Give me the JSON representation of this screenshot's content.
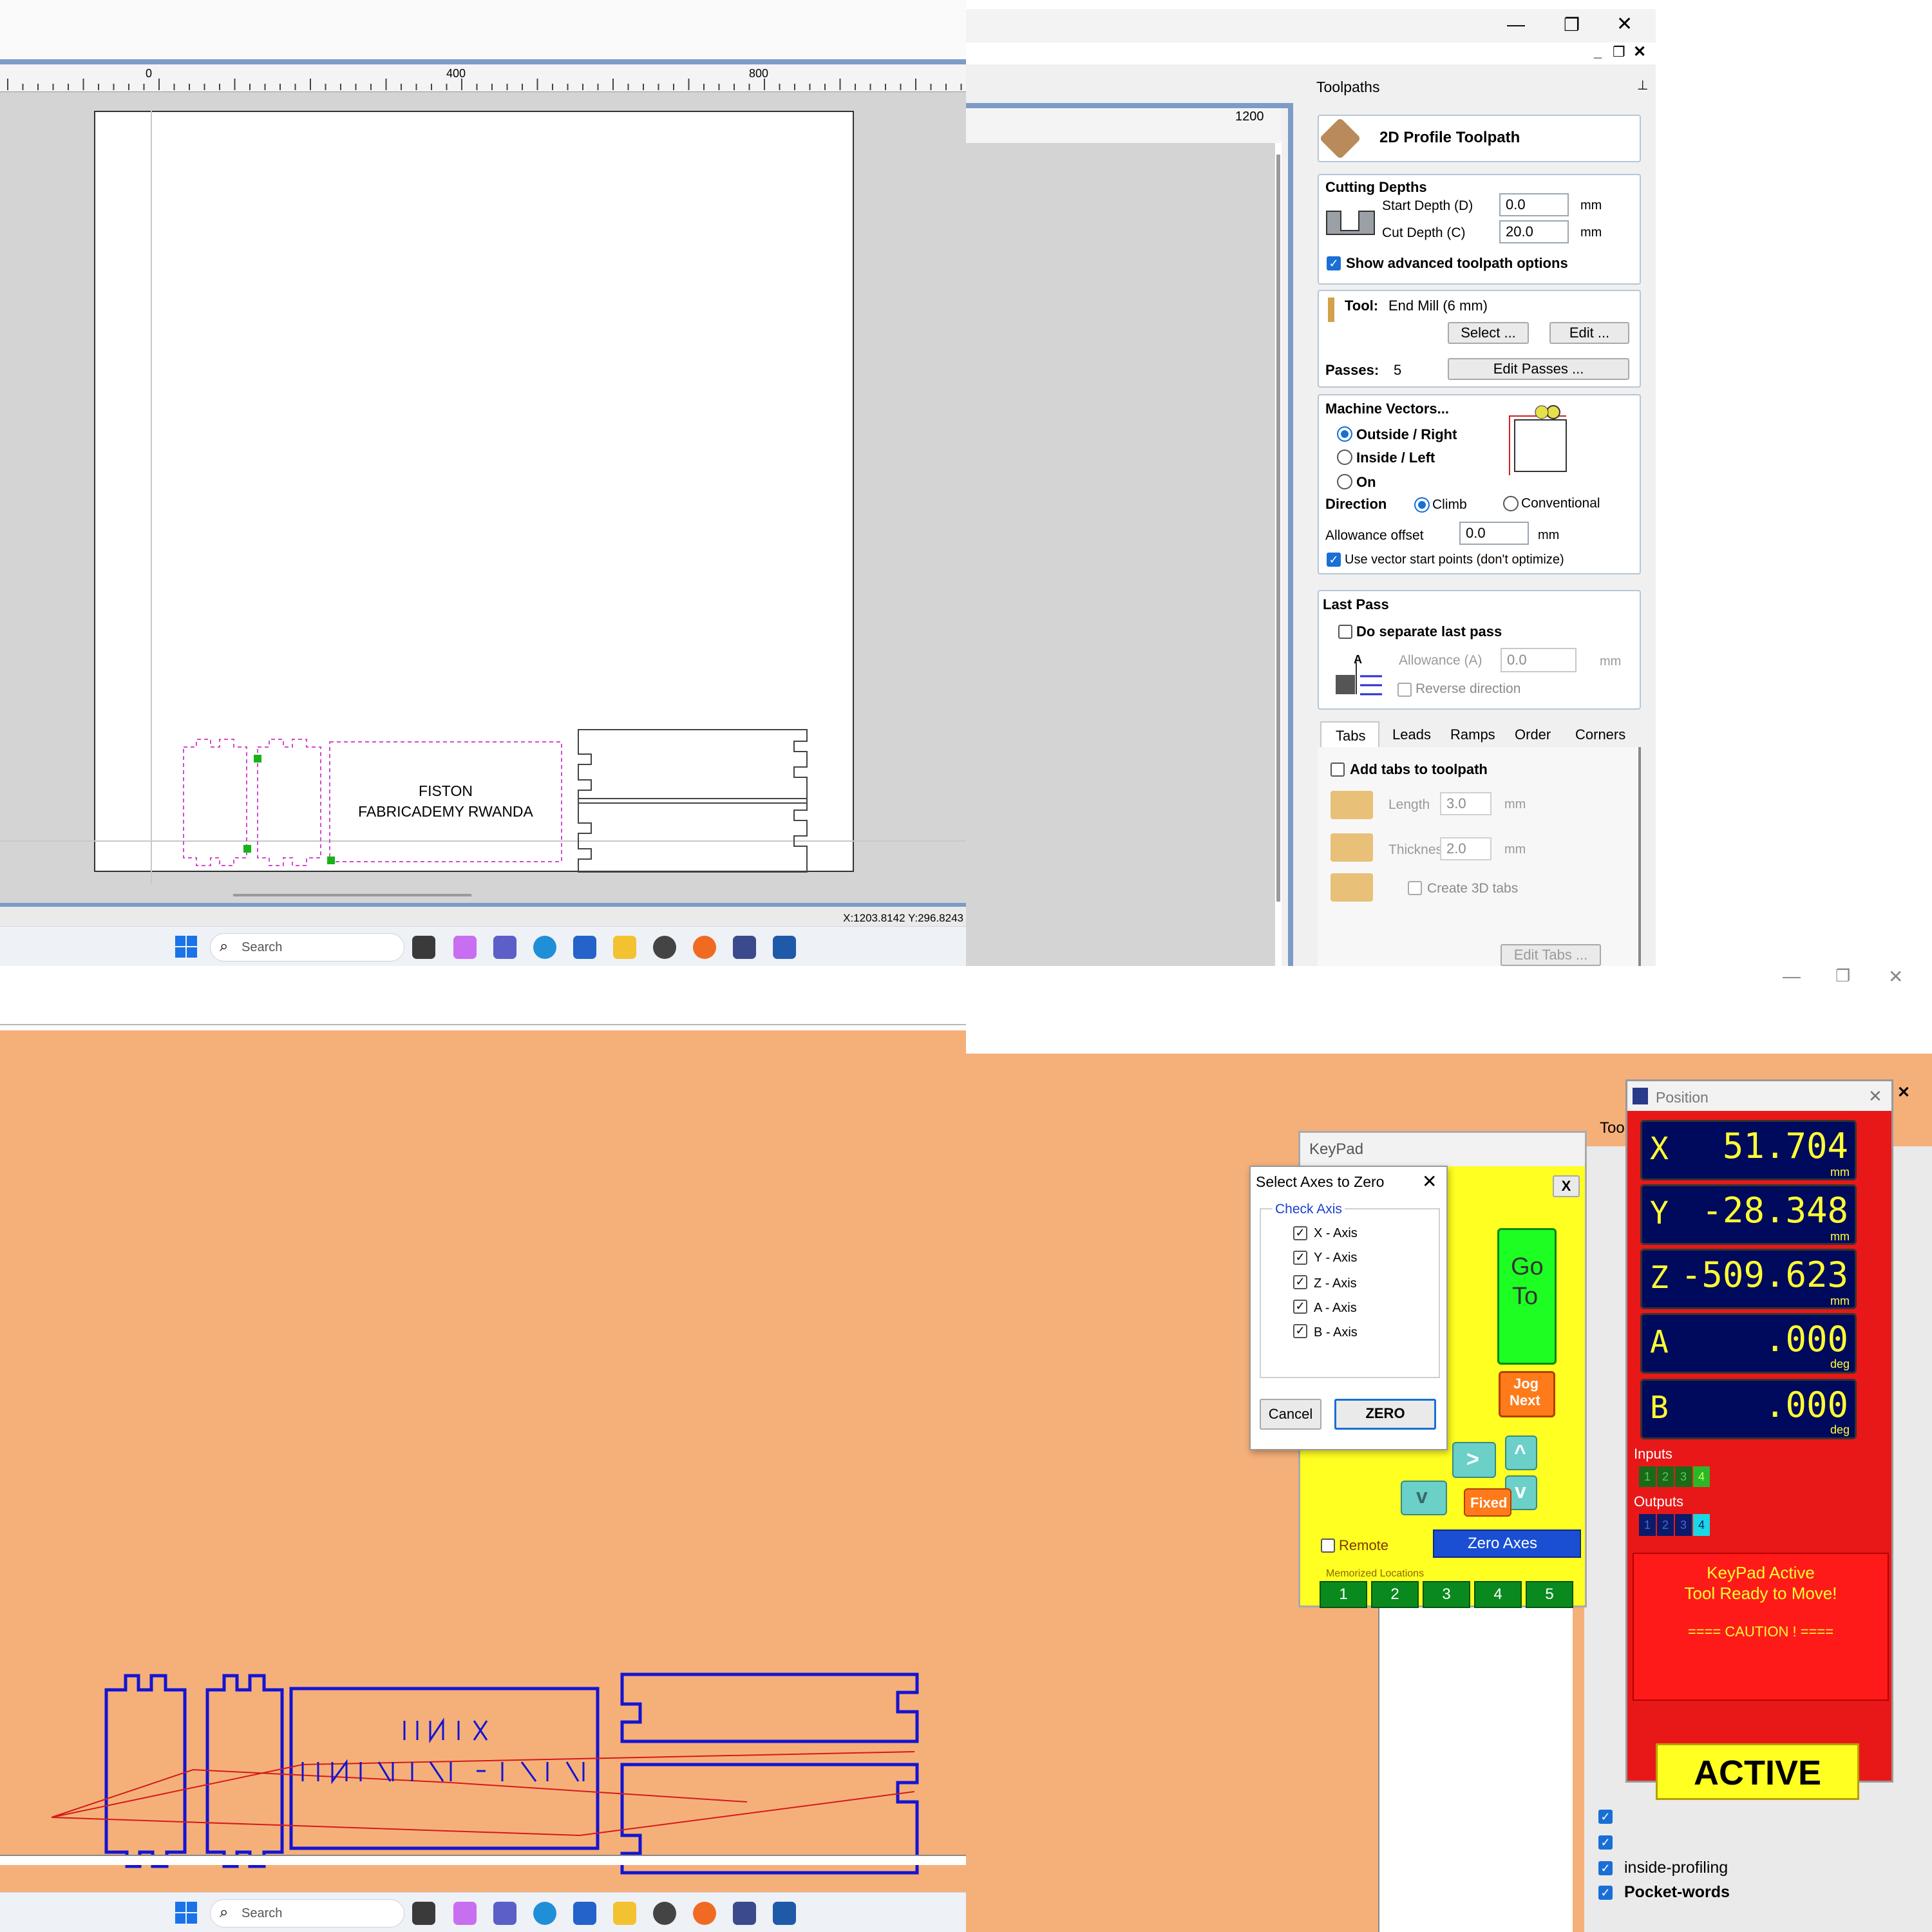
{
  "design_view": {
    "ruler_labels": [
      "0",
      "400",
      "800",
      "1200"
    ],
    "part_text_line1": "FISTON",
    "part_text_line2": "FABRICADEMY RWANDA",
    "coords": "X:1203.8142 Y:296.8243"
  },
  "window_controls": {
    "minimize": "—",
    "restore": "❐",
    "close": "✕"
  },
  "taskbar": {
    "search_placeholder": "Search"
  },
  "toolpaths": {
    "panel_title": "Toolpaths",
    "toolpath_name": "2D Profile Toolpath",
    "cutting_depths": {
      "title": "Cutting Depths",
      "start_label": "Start Depth (D)",
      "start_value": "0.0",
      "cut_label": "Cut Depth (C)",
      "cut_value": "20.0",
      "unit": "mm",
      "advanced_label": "Show advanced toolpath options"
    },
    "tool": {
      "label": "Tool:",
      "value": "End Mill (6 mm)",
      "select_btn": "Select ...",
      "edit_btn": "Edit ...",
      "passes_label": "Passes:",
      "passes_value": "5",
      "edit_passes_btn": "Edit Passes ..."
    },
    "machine_vectors": {
      "title": "Machine Vectors...",
      "outside": "Outside / Right",
      "inside": "Inside / Left",
      "on": "On",
      "direction_label": "Direction",
      "climb": "Climb",
      "conventional": "Conventional",
      "allowance_label": "Allowance offset",
      "allowance_value": "0.0",
      "unit": "mm",
      "start_points_label": "Use vector start points (don't optimize)"
    },
    "last_pass": {
      "title": "Last Pass",
      "separate_label": "Do separate last pass",
      "allowance_label": "Allowance (A)",
      "allowance_value": "0.0",
      "unit": "mm",
      "reverse_label": "Reverse direction",
      "a_letter": "A"
    },
    "tabs": [
      "Tabs",
      "Leads",
      "Ramps",
      "Order",
      "Corners"
    ],
    "tabs_section": {
      "add_tabs_label": "Add tabs to toolpath",
      "length_label": "Length",
      "length_value": "3.0",
      "thickness_label": "Thickness",
      "thickness_value": "2.0",
      "unit": "mm",
      "create3d_label": "Create 3D tabs",
      "edit_tabs_btn": "Edit Tabs ..."
    }
  },
  "cnc": {
    "select_axes_dialog": {
      "title": "Select Axes to Zero",
      "group_label": "Check Axis",
      "axes": [
        "X - Axis",
        "Y - Axis",
        "Z - Axis",
        "A - Axis",
        "B - Axis"
      ],
      "cancel_btn": "Cancel",
      "zero_btn": "ZERO"
    },
    "keypad": {
      "title": "KeyPad",
      "close": "X",
      "goto": [
        "Go",
        "To"
      ],
      "jog_next": [
        "Jog",
        "Next"
      ],
      "fixed": "Fixed",
      "remote": "Remote",
      "zero_axes": "Zero Axes",
      "memorized_label": "Memorized Locations",
      "memorized": [
        "1",
        "2",
        "3",
        "4",
        "5"
      ],
      "arrows": {
        "right": ">",
        "up": "^",
        "down": "v"
      }
    },
    "position": {
      "title": "Position",
      "axes": [
        {
          "letter": "X",
          "value": "51.704",
          "unit": "mm"
        },
        {
          "letter": "Y",
          "value": "-28.348",
          "unit": "mm"
        },
        {
          "letter": "Z",
          "value": "-509.623",
          "unit": "mm"
        },
        {
          "letter": "A",
          "value": ".000",
          "unit": "deg"
        },
        {
          "letter": "B",
          "value": ".000",
          "unit": "deg"
        }
      ],
      "inputs_label": "Inputs",
      "inputs": [
        "1",
        "2",
        "3",
        "4"
      ],
      "outputs_label": "Outputs",
      "outputs": [
        "1",
        "2",
        "3",
        "4"
      ],
      "status_line1": "KeyPad Active",
      "status_line2": "Tool Ready to Move!",
      "caution": "==== CAUTION ! ====",
      "active_label": "ACTIVE"
    },
    "toolpath_list": {
      "partial_label": "Too",
      "items": [
        "inside-profiling",
        "Pocket-words"
      ]
    }
  },
  "colors": {
    "accent": "#1a6fd6",
    "keypad_yellow": "#ffff33",
    "position_red": "#e81818",
    "toolpath_blue": "#1414d4"
  }
}
